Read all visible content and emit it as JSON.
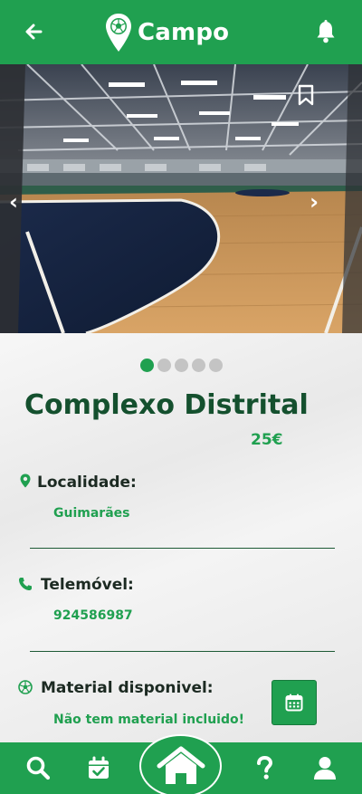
{
  "header": {
    "title": "Campo"
  },
  "venue": {
    "name": "Complexo Distrital",
    "price": "25€",
    "carousel": {
      "count": 5,
      "active": 1
    }
  },
  "fields": {
    "locality_label": "Localidade:",
    "locality_value": "Guimarães",
    "phone_label": "Telemóvel:",
    "phone_value": "924586987",
    "material_label": "Material disponivel:",
    "material_value": "Não tem material incluido!"
  },
  "colors": {
    "brand_green": "#20a050",
    "dark_green": "#14502e"
  },
  "icons": {
    "header": [
      "back-arrow-icon",
      "ball-pin-logo-icon",
      "bell-icon"
    ],
    "hero": [
      "chevron-left-icon",
      "chevron-right-icon",
      "bookmark-icon"
    ],
    "fields": [
      "map-pin-icon",
      "phone-icon",
      "soccer-ball-icon",
      "calendar-icon"
    ],
    "nav": [
      "search-icon",
      "calendar-check-icon",
      "home-icon",
      "question-icon",
      "user-icon"
    ]
  }
}
